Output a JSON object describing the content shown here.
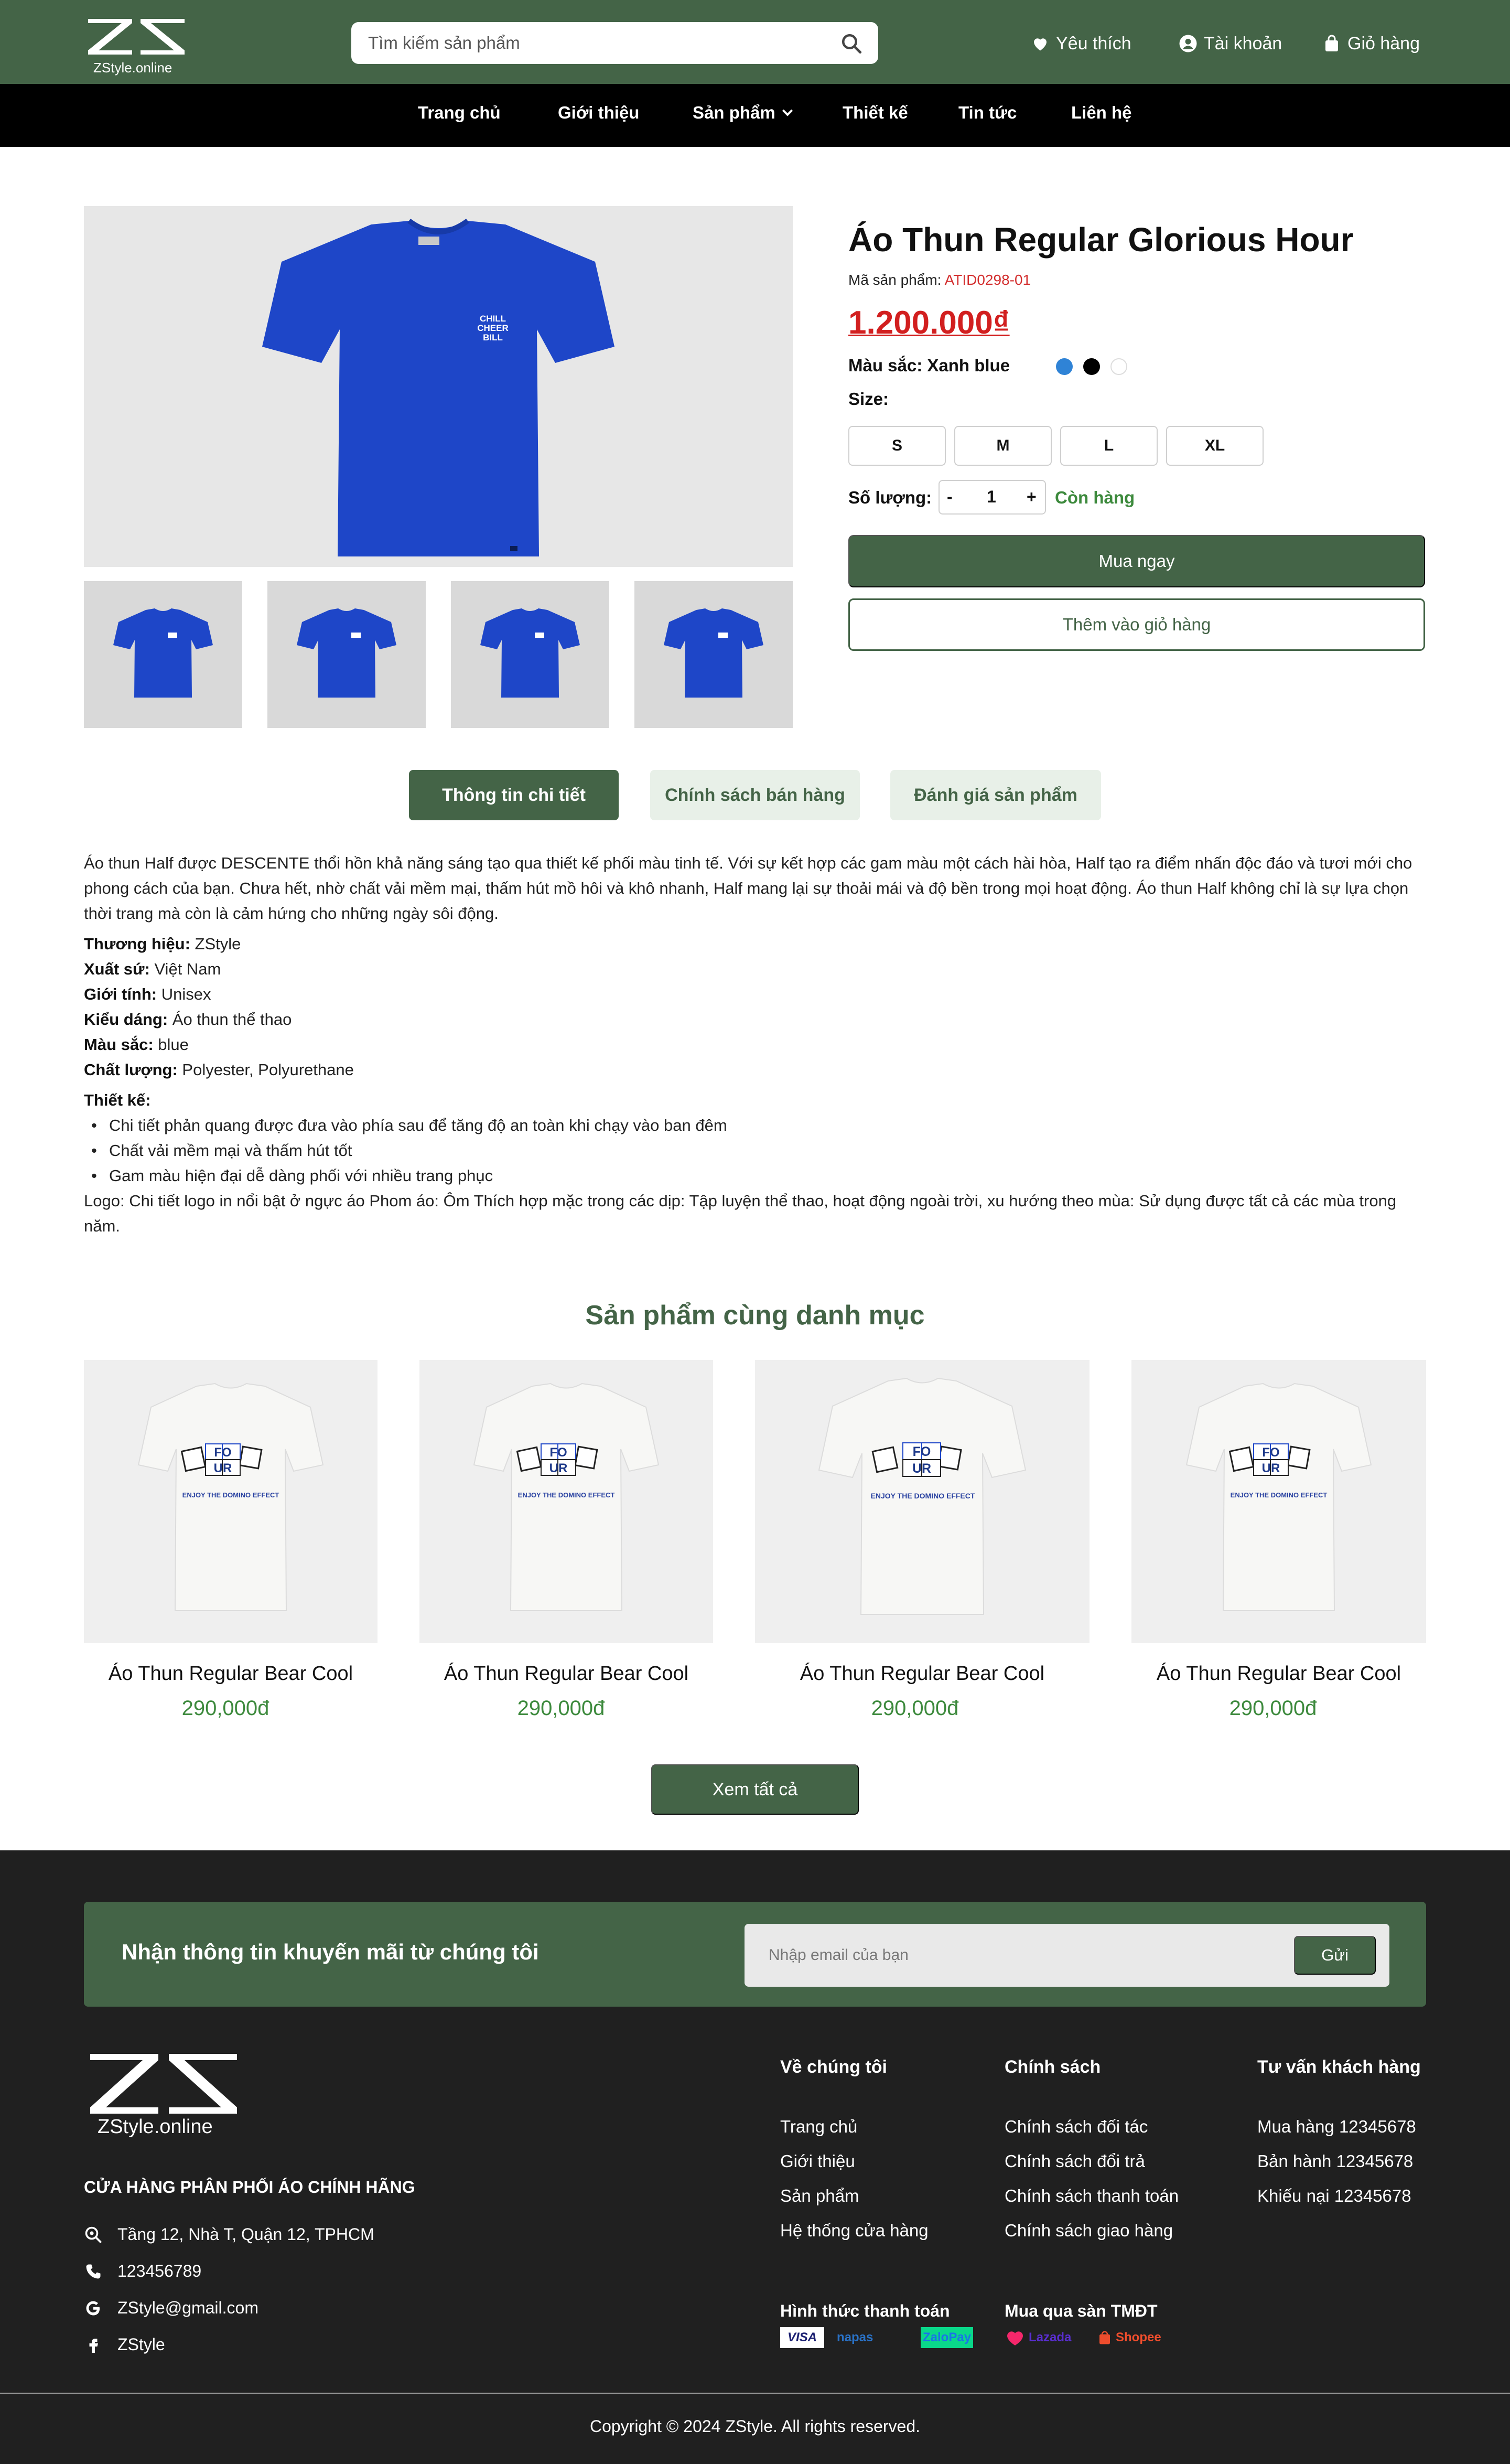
{
  "brand": {
    "name": "ZStyle.online"
  },
  "search": {
    "placeholder": "Tìm kiếm sản phẩm"
  },
  "header": {
    "wishlist": "Yêu thích",
    "account": "Tài khoản",
    "cart": "Giỏ hàng"
  },
  "nav": {
    "items": [
      "Trang chủ",
      "Giới thiệu",
      "Sản phẩm",
      "Thiết kế",
      "Tin tức",
      "Liên hệ"
    ]
  },
  "product": {
    "title": "Áo Thun Regular Glorious Hour",
    "sku_label": "Mã sản phẩm:",
    "sku": "ATID0298-01",
    "price": "1.200.000₫",
    "color_label": "Màu sắc: Xanh blue",
    "colors": [
      "#2f83d6",
      "#000000",
      "#ffffff"
    ],
    "size_label": "Size:",
    "sizes": [
      "S",
      "M",
      "L",
      "XL"
    ],
    "qty_label": "Số lượng:",
    "qty_minus": "-",
    "qty_value": "1",
    "qty_plus": "+",
    "stock": "Còn hàng",
    "buy_now": "Mua ngay",
    "add_to_cart": "Thêm vào giỏ hàng",
    "main_color": "#1e46c8"
  },
  "tabs": [
    "Thông tin chi tiết",
    "Chính sách bán hàng",
    "Đánh giá sản phẩm"
  ],
  "description": {
    "intro": "Áo thun Half được DESCENTE thổi hồn khả năng sáng tạo qua thiết kế phối màu tinh tế. Với sự kết hợp các gam màu một cách hài hòa, Half tạo ra điểm nhấn độc đáo và tươi mới cho phong cách của bạn. Chưa hết, nhờ chất vải mềm mại, thấm hút mồ hôi và khô nhanh, Half mang lại sự thoải mái và độ bền trong mọi hoạt động. Áo thun Half không chỉ là sự lựa chọn thời trang mà còn là cảm hứng cho những ngày sôi động.",
    "specs": [
      {
        "k": "Thương hiệu:",
        "v": "ZStyle"
      },
      {
        "k": "Xuất sứ:",
        "v": "Việt Nam"
      },
      {
        "k": "Giới tính:",
        "v": "Unisex"
      },
      {
        "k": "Kiểu dáng:",
        "v": "Áo thun thể thao"
      },
      {
        "k": "Màu sắc:",
        "v": "blue"
      },
      {
        "k": "Chất lượng:",
        "v": "Polyester, Polyurethane"
      }
    ],
    "design_label": "Thiết kế:",
    "design_points": [
      "Chi tiết phản quang được đưa vào phía sau để tăng độ an toàn khi chạy vào ban đêm",
      "Chất vải mềm mại và thấm hút tốt",
      "Gam màu hiện đại dễ dàng phối với nhiều trang phục"
    ],
    "logo_note": "Logo: Chi tiết logo in nổi bật ở ngực áo Phom áo: Ôm Thích hợp mặc trong các dịp: Tập luyện thể thao, hoạt động ngoài trời, xu hướng theo mùa: Sử dụng được tất cả các mùa trong năm."
  },
  "related": {
    "title": "Sản phẩm cùng danh mục",
    "items": [
      {
        "name": "Áo Thun Regular Bear Cool",
        "price": "290,000đ"
      },
      {
        "name": "Áo Thun Regular Bear Cool",
        "price": "290,000đ"
      },
      {
        "name": "Áo Thun Regular Bear Cool",
        "price": "290,000đ"
      },
      {
        "name": "Áo Thun Regular Bear Cool",
        "price": "290,000đ"
      }
    ],
    "print_lines": [
      "FO",
      "UR",
      "ENJOY THE DOMINO EFFECT"
    ],
    "see_all": "Xem tất cả"
  },
  "newsletter": {
    "title": "Nhận thông tin khuyến mãi từ chúng tôi",
    "placeholder": "Nhập email của bạn",
    "send": "Gửi"
  },
  "footer": {
    "brand": "ZStyle.online",
    "shop_title": "CỬA HÀNG PHÂN PHỐI ÁO CHÍNH HÃNG",
    "address": "Tầng 12, Nhà T, Quận 12, TPHCM",
    "phone": "123456789",
    "email": "ZStyle@gmail.com",
    "facebook": "ZStyle",
    "about_title": "Về chúng tôi",
    "about_links": [
      "Trang chủ",
      "Giới thiệu",
      "Sản phẩm",
      "Hệ thống cửa hàng"
    ],
    "policy_title": "Chính sách",
    "policy_links": [
      "Chính sách đối tác",
      "Chính sách đổi trả",
      "Chính sách thanh toán",
      "Chính sách giao hàng"
    ],
    "support_title": "Tư vấn khách hàng",
    "support_links": [
      "Mua hàng 12345678",
      "Bản hành 12345678",
      "Khiếu nại 12345678"
    ],
    "payment_title": "Hình thức thanh toán",
    "payments": [
      "VISA",
      "napas",
      "ZaloPay"
    ],
    "marketplace_title": "Mua qua sàn TMĐT",
    "marketplaces": [
      "Lazada",
      "Shopee"
    ],
    "copyright": "Copyright © 2024 ZStyle. All rights reserved."
  }
}
